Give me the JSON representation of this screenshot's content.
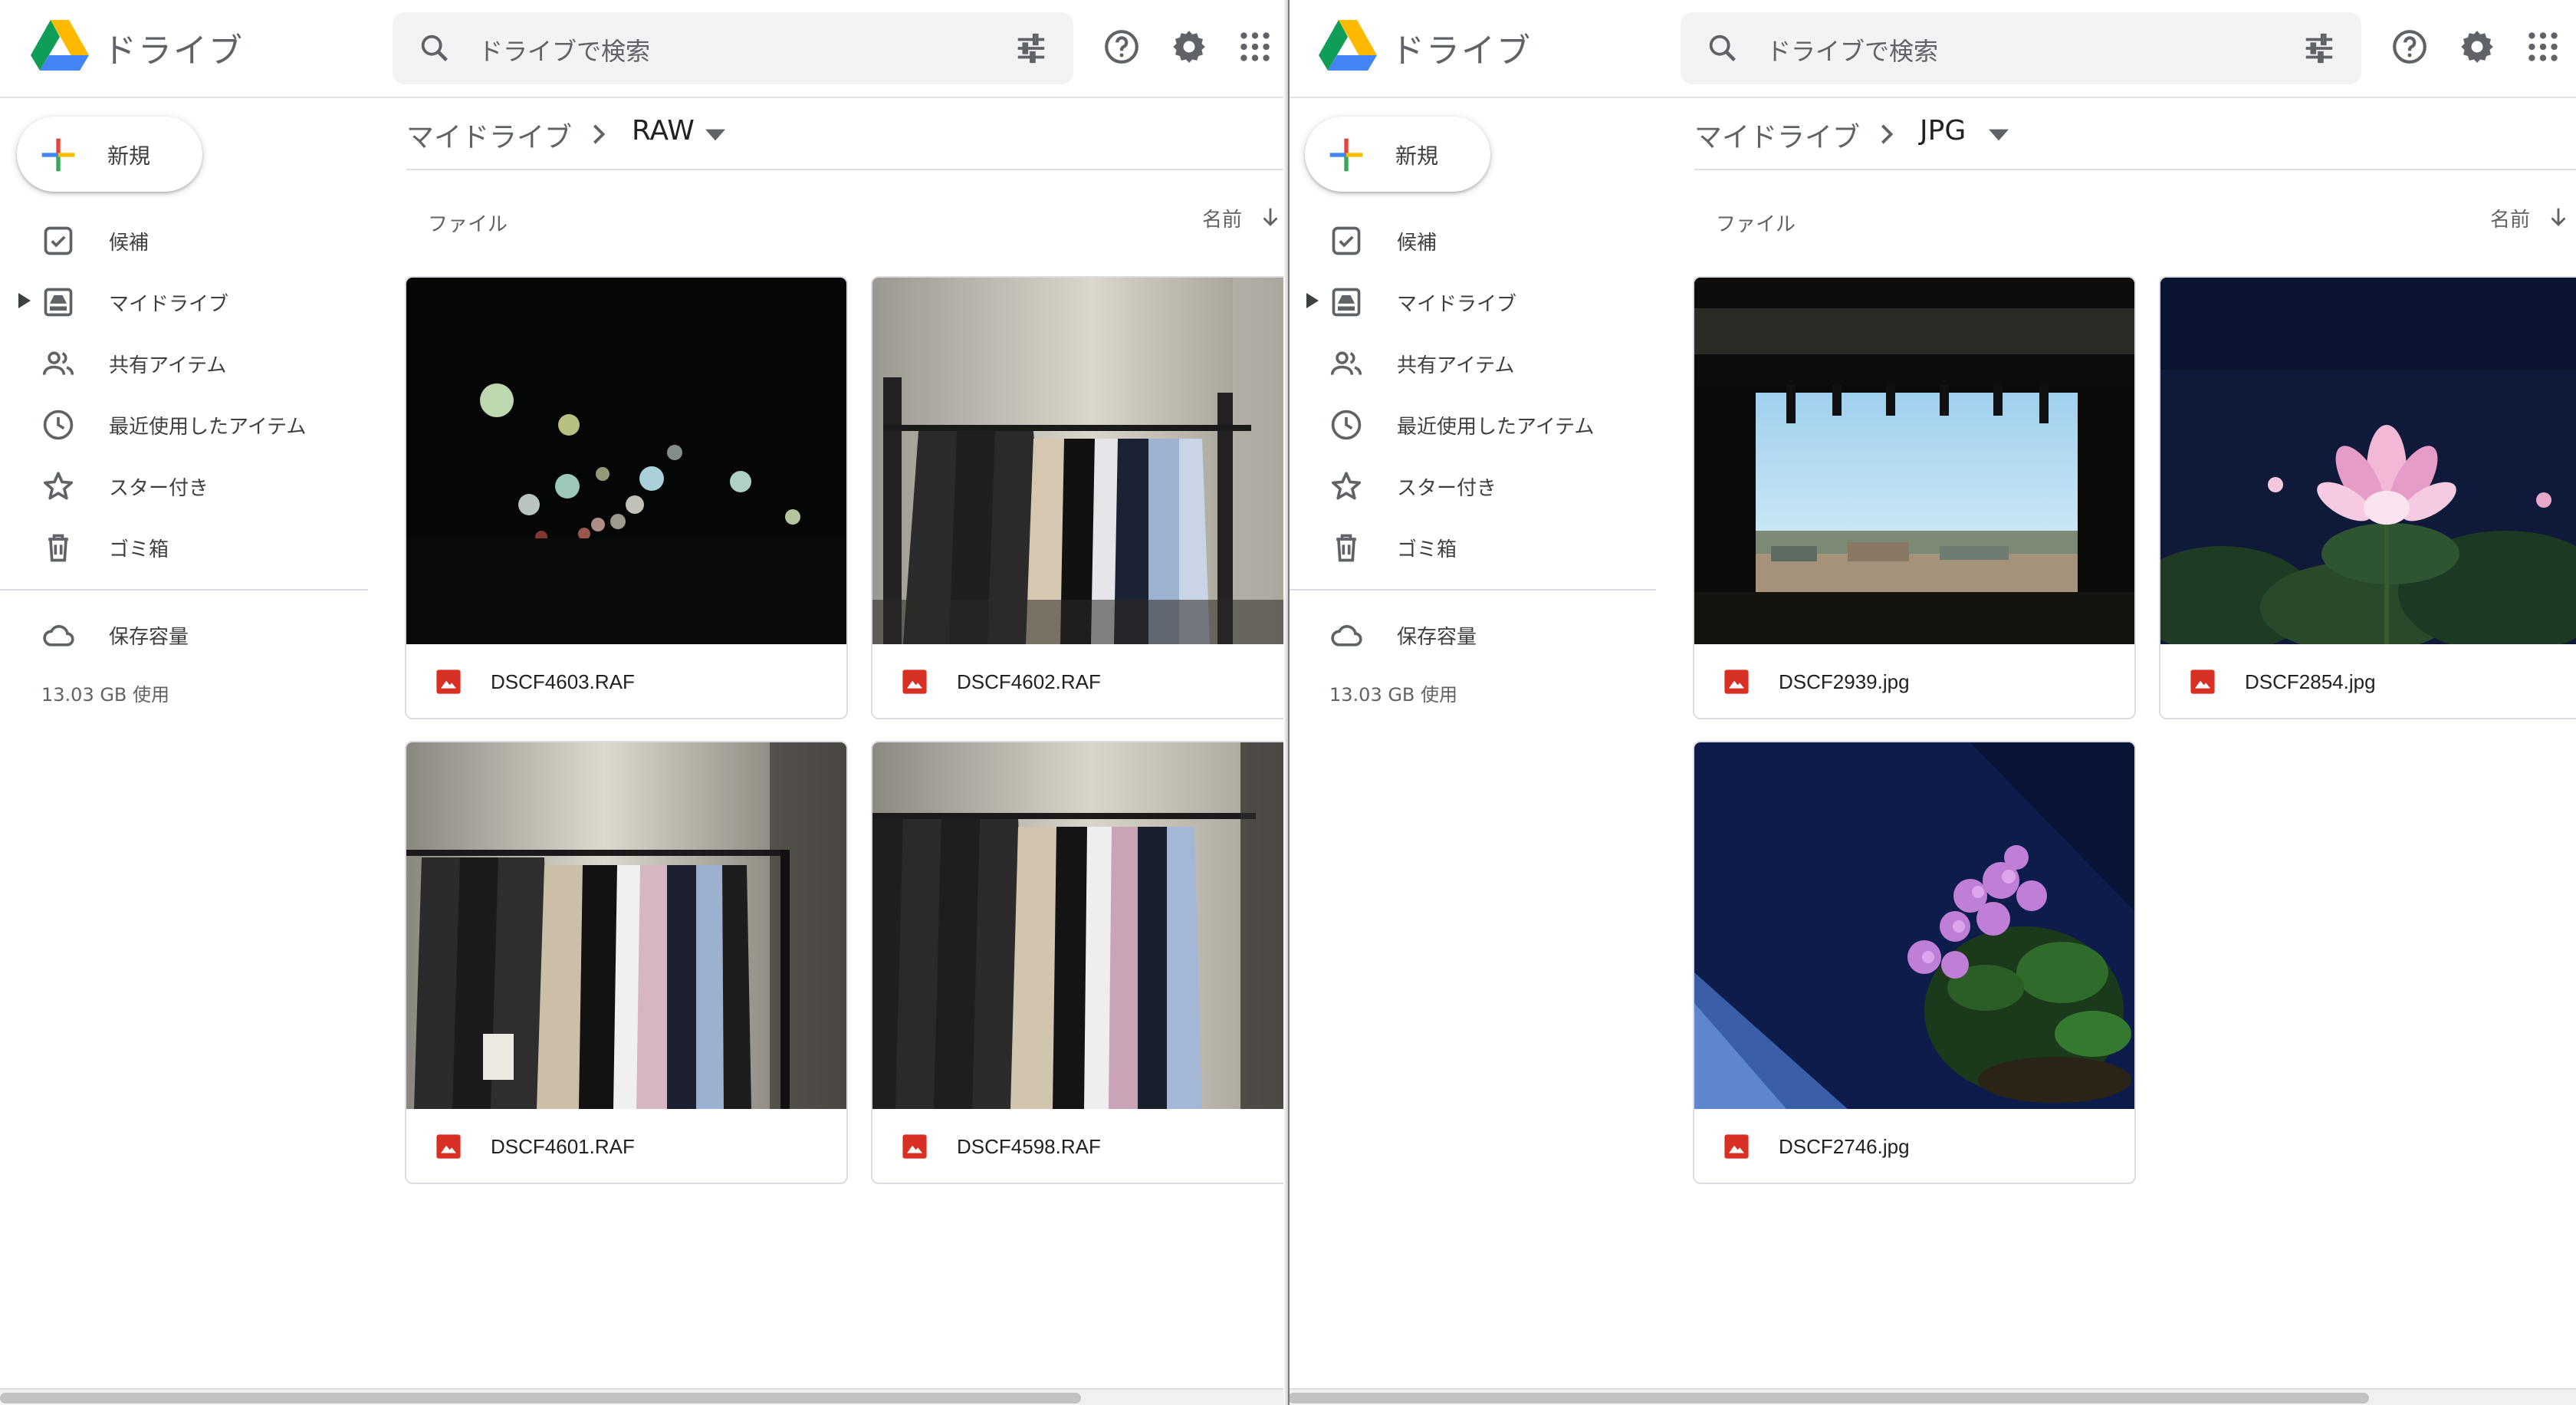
{
  "colors": {
    "accent": "#1a73e8",
    "file_red": "#d93025",
    "icon_gray": "#5f6368"
  },
  "panes": [
    {
      "app_name": "ドライブ",
      "search_placeholder": "ドライブで検索",
      "new_button_label": "新規",
      "nav": [
        "候補",
        "マイドライブ",
        "共有アイテム",
        "最近使用したアイテム",
        "スター付き",
        "ゴミ箱"
      ],
      "storage_label": "保存容量",
      "storage_usage": "13.03 GB 使用",
      "breadcrumb_root": "マイドライブ",
      "breadcrumb_current": "RAW",
      "section_label": "ファイル",
      "sort_label": "名前",
      "files": [
        "DSCF4603.RAF",
        "DSCF4602.RAF",
        "DSCF4601.RAF",
        "DSCF4598.RAF"
      ]
    },
    {
      "app_name": "ドライブ",
      "search_placeholder": "ドライブで検索",
      "new_button_label": "新規",
      "nav": [
        "候補",
        "マイドライブ",
        "共有アイテム",
        "最近使用したアイテム",
        "スター付き",
        "ゴミ箱"
      ],
      "storage_label": "保存容量",
      "storage_usage": "13.03 GB 使用",
      "breadcrumb_root": "マイドライブ",
      "breadcrumb_current": "JPG",
      "section_label": "ファイル",
      "sort_label": "名前",
      "files": [
        "DSCF2939.jpg",
        "DSCF2854.jpg",
        "DSCF2746.jpg"
      ]
    }
  ]
}
